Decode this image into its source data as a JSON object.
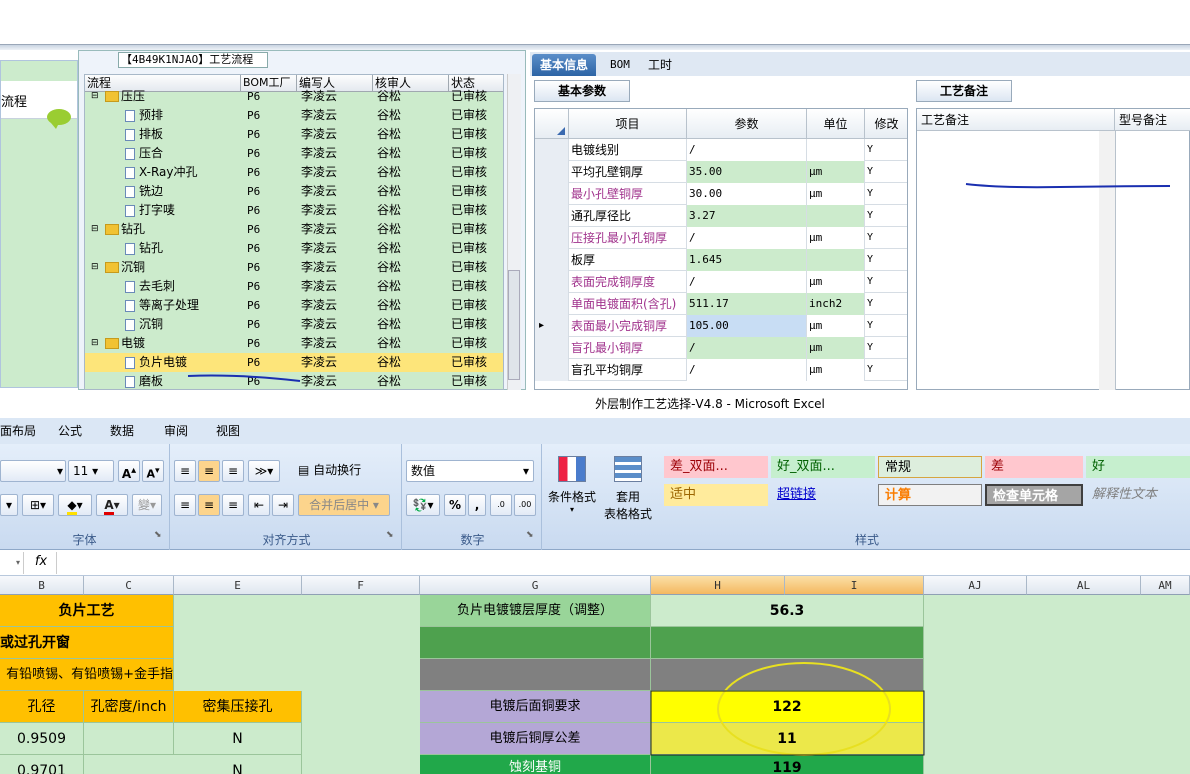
{
  "process_panel": {
    "title": "【4B49K1NJAO】工艺流程",
    "left_nav_label": "流程",
    "columns": [
      "流程",
      "BOM工厂",
      "编写人",
      "核审人",
      "状态"
    ],
    "rows": [
      {
        "name": "压压",
        "type": "folder",
        "level": 1,
        "plant": "P6",
        "author": "李凌云",
        "reviewer": "谷松",
        "status": "已审核"
      },
      {
        "name": "预排",
        "type": "doc",
        "level": 2,
        "plant": "P6",
        "author": "李凌云",
        "reviewer": "谷松",
        "status": "已审核"
      },
      {
        "name": "排板",
        "type": "doc",
        "level": 2,
        "plant": "P6",
        "author": "李凌云",
        "reviewer": "谷松",
        "status": "已审核"
      },
      {
        "name": "压合",
        "type": "doc",
        "level": 2,
        "plant": "P6",
        "author": "李凌云",
        "reviewer": "谷松",
        "status": "已审核"
      },
      {
        "name": "X-Ray冲孔",
        "type": "doc",
        "level": 2,
        "plant": "P6",
        "author": "李凌云",
        "reviewer": "谷松",
        "status": "已审核"
      },
      {
        "name": "铣边",
        "type": "doc",
        "level": 2,
        "plant": "P6",
        "author": "李凌云",
        "reviewer": "谷松",
        "status": "已审核"
      },
      {
        "name": "打字唛",
        "type": "doc",
        "level": 2,
        "plant": "P6",
        "author": "李凌云",
        "reviewer": "谷松",
        "status": "已审核"
      },
      {
        "name": "钻孔",
        "type": "folder",
        "level": 1,
        "plant": "P6",
        "author": "李凌云",
        "reviewer": "谷松",
        "status": "已审核"
      },
      {
        "name": "钻孔",
        "type": "doc",
        "level": 2,
        "plant": "P6",
        "author": "李凌云",
        "reviewer": "谷松",
        "status": "已审核"
      },
      {
        "name": "沉铜",
        "type": "folder",
        "level": 1,
        "plant": "P6",
        "author": "李凌云",
        "reviewer": "谷松",
        "status": "已审核"
      },
      {
        "name": "去毛刺",
        "type": "doc",
        "level": 2,
        "plant": "P6",
        "author": "李凌云",
        "reviewer": "谷松",
        "status": "已审核"
      },
      {
        "name": "等离子处理",
        "type": "doc",
        "level": 2,
        "plant": "P6",
        "author": "李凌云",
        "reviewer": "谷松",
        "status": "已审核"
      },
      {
        "name": "沉铜",
        "type": "doc",
        "level": 2,
        "plant": "P6",
        "author": "李凌云",
        "reviewer": "谷松",
        "status": "已审核"
      },
      {
        "name": "电镀",
        "type": "folder",
        "level": 1,
        "plant": "P6",
        "author": "李凌云",
        "reviewer": "谷松",
        "status": "已审核"
      },
      {
        "name": "负片电镀",
        "type": "doc",
        "level": 2,
        "plant": "P6",
        "author": "李凌云",
        "reviewer": "谷松",
        "status": "已审核",
        "selected": true
      },
      {
        "name": "磨板",
        "type": "doc",
        "level": 2,
        "plant": "P6",
        "author": "李凌云",
        "reviewer": "谷松",
        "status": "已审核"
      }
    ]
  },
  "info_panel": {
    "tabs": [
      "基本信息",
      "BOM",
      "工时"
    ],
    "subtab": "基本参数",
    "columns": [
      "项目",
      "参数",
      "单位",
      "修改"
    ],
    "rows": [
      {
        "item": "电镀线别",
        "param": "/",
        "unit": "",
        "mod": "Y",
        "purple": false
      },
      {
        "item": "平均孔壁铜厚",
        "param": "35.00",
        "unit": "μm",
        "mod": "Y",
        "purple": false
      },
      {
        "item": "最小孔壁铜厚",
        "param": "30.00",
        "unit": "μm",
        "mod": "Y",
        "purple": true
      },
      {
        "item": "通孔厚径比",
        "param": "3.27",
        "unit": "",
        "mod": "Y",
        "purple": false
      },
      {
        "item": "压接孔最小孔铜厚",
        "param": "/",
        "unit": "μm",
        "mod": "Y",
        "purple": true
      },
      {
        "item": "板厚",
        "param": "1.645",
        "unit": "",
        "mod": "Y",
        "purple": false
      },
      {
        "item": "表面完成铜厚度",
        "param": "/",
        "unit": "μm",
        "mod": "Y",
        "purple": true
      },
      {
        "item": "单面电镀面积(含孔)",
        "param": "511.17",
        "unit": "inch2",
        "mod": "Y",
        "purple": true
      },
      {
        "item": "表面最小完成铜厚",
        "param": "105.00",
        "unit": "μm",
        "mod": "Y",
        "purple": true,
        "current": true
      },
      {
        "item": "盲孔最小铜厚",
        "param": "/",
        "unit": "μm",
        "mod": "Y",
        "purple": true
      },
      {
        "item": "盲孔平均铜厚",
        "param": "/",
        "unit": "μm",
        "mod": "Y",
        "purple": false
      }
    ],
    "note_subtab": "工艺备注",
    "note_columns": [
      "工艺备注",
      "型号备注"
    ]
  },
  "excel": {
    "title": "外层制作工艺选择-V4.8 - Microsoft Excel",
    "menu": [
      "面布局",
      "公式",
      "数据",
      "审阅",
      "视图"
    ],
    "font_size": "11",
    "groups": {
      "font": "字体",
      "align": "对齐方式",
      "number": "数字",
      "styles": "样式"
    },
    "wrap_text": "自动换行",
    "merge_center": "合并后居中",
    "number_format": "数值",
    "cond_format": "条件格式",
    "table_format_1": "套用",
    "table_format_2": "表格格式",
    "styles": [
      "差_双面...",
      "好_双面...",
      "常规",
      "差",
      "好",
      "适中",
      "超链接",
      "计算",
      "检查单元格",
      "解释性文本"
    ],
    "style_colors": {
      "bad": "#ffc7ce",
      "good": "#c6efce",
      "neutral": "#ffeb9c"
    },
    "fx": "fx",
    "columns": [
      "B",
      "C",
      "E",
      "F",
      "G",
      "H",
      "I",
      "AJ",
      "AL",
      "AM"
    ],
    "cells": {
      "neg_process": "负片工艺",
      "via_open": "或过孔开窗",
      "hasl": "有铅喷锡、有铅喷锡+金手指",
      "hole_dia": "孔径",
      "hole_density": "孔密度/inch",
      "press_fit": "密集压接孔",
      "r1_b": "0.9509",
      "r1_e": "N",
      "r2_b": "0.9701",
      "r2_e": "N",
      "g_label_1": "负片电镀镀层厚度（调整）",
      "h_value_1": "56.3",
      "g_label_4": "电镀后面铜要求",
      "h_value_4": "122",
      "g_label_5": "电镀后铜厚公差",
      "h_value_5": "11",
      "g_label_6": "蚀刻基铜",
      "h_value_6": "119"
    }
  }
}
